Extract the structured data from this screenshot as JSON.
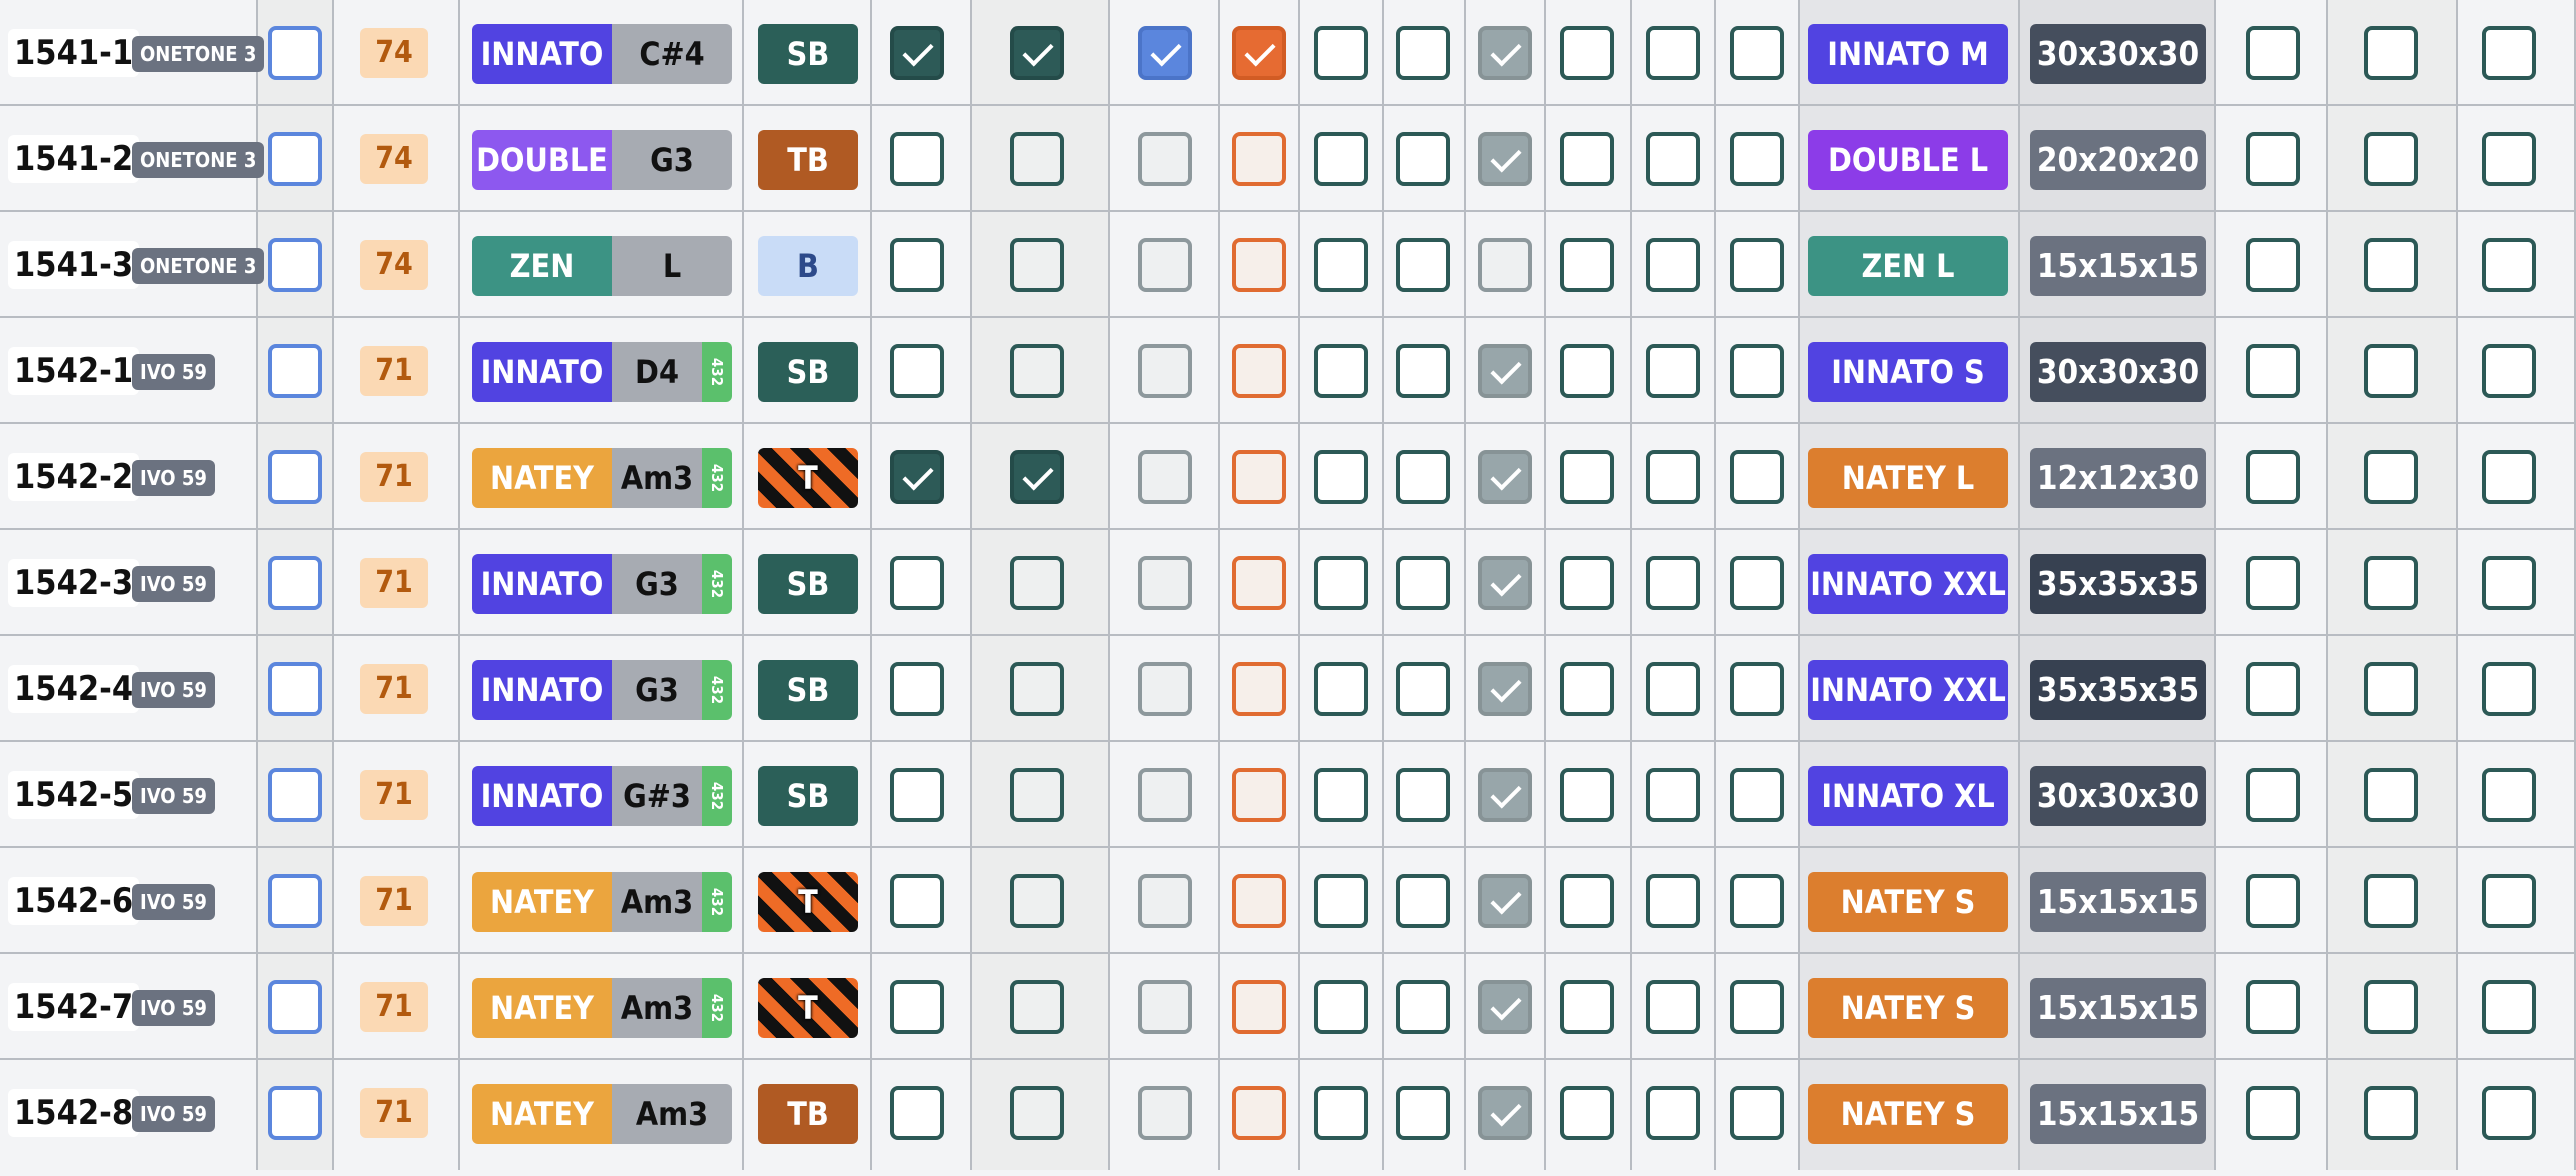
{
  "colors": {
    "INNATO": "#5143e1",
    "DOUBLE": "#8d58ef",
    "ZEN": "#3c9384",
    "NATEY": "#eba53e",
    "box_INNATO": "#5143e1",
    "box_DOUBLE": "#8c3ce8",
    "box_ZEN": "#3c9384",
    "box_NATEY": "#dc7e2e",
    "bag_SB": "#2b5f58",
    "bag_TB": "#b05a23",
    "bag_B": "#c9dcf7",
    "size_30x30x30": "#454e5d",
    "size_20x20x20": "#6b7280",
    "size_15x15x15": "#6b7280",
    "size_12x12x30": "#6b7280",
    "size_35x35x35": "#374151"
  },
  "rows": [
    {
      "order": "1541-1",
      "model": "ONETONE 3",
      "tuning": "74",
      "instrument": "INNATO",
      "note": "C#4",
      "hz": "",
      "bag": "SB",
      "bag_style": "solid",
      "box": "INNATO M",
      "size": "30x30x30",
      "checks": {
        "c1": false,
        "c2": true,
        "c3": true,
        "c4": true,
        "c5": true,
        "c6": false,
        "c7": false,
        "c8": true,
        "c9": false,
        "c10": false,
        "c11": false,
        "c12": false,
        "c13": false,
        "c14": false
      }
    },
    {
      "order": "1541-2",
      "model": "ONETONE 3",
      "tuning": "74",
      "instrument": "DOUBLE",
      "note": "G3",
      "hz": "",
      "bag": "TB",
      "bag_style": "solid",
      "box": "DOUBLE L",
      "size": "20x20x20",
      "checks": {
        "c1": false,
        "c2": false,
        "c3": false,
        "c4": false,
        "c5": false,
        "c6": false,
        "c7": false,
        "c8": true,
        "c9": false,
        "c10": false,
        "c11": false,
        "c12": false,
        "c13": false,
        "c14": false
      }
    },
    {
      "order": "1541-3",
      "model": "ONETONE 3",
      "tuning": "74",
      "instrument": "ZEN",
      "note": "L",
      "hz": "",
      "bag": "B",
      "bag_style": "solid",
      "box": "ZEN L",
      "size": "15x15x15",
      "checks": {
        "c1": false,
        "c2": false,
        "c3": false,
        "c4": false,
        "c5": false,
        "c6": false,
        "c7": false,
        "c8": false,
        "c9": false,
        "c10": false,
        "c11": false,
        "c12": false,
        "c13": false,
        "c14": false
      }
    },
    {
      "order": "1542-1",
      "model": "IVO 59",
      "tuning": "71",
      "instrument": "INNATO",
      "note": "D4",
      "hz": "432",
      "bag": "SB",
      "bag_style": "solid",
      "box": "INNATO S",
      "size": "30x30x30",
      "checks": {
        "c1": false,
        "c2": false,
        "c3": false,
        "c4": false,
        "c5": false,
        "c6": false,
        "c7": false,
        "c8": true,
        "c9": false,
        "c10": false,
        "c11": false,
        "c12": false,
        "c13": false,
        "c14": false
      }
    },
    {
      "order": "1542-2",
      "model": "IVO 59",
      "tuning": "71",
      "instrument": "NATEY",
      "note": "Am3",
      "hz": "432",
      "bag": "T",
      "bag_style": "stripe",
      "box": "NATEY L",
      "size": "12x12x30",
      "checks": {
        "c1": false,
        "c2": true,
        "c3": true,
        "c4": false,
        "c5": false,
        "c6": false,
        "c7": false,
        "c8": true,
        "c9": false,
        "c10": false,
        "c11": false,
        "c12": false,
        "c13": false,
        "c14": false
      }
    },
    {
      "order": "1542-3",
      "model": "IVO 59",
      "tuning": "71",
      "instrument": "INNATO",
      "note": "G3",
      "hz": "432",
      "bag": "SB",
      "bag_style": "solid",
      "box": "INNATO XXL",
      "size": "35x35x35",
      "checks": {
        "c1": false,
        "c2": false,
        "c3": false,
        "c4": false,
        "c5": false,
        "c6": false,
        "c7": false,
        "c8": true,
        "c9": false,
        "c10": false,
        "c11": false,
        "c12": false,
        "c13": false,
        "c14": false
      }
    },
    {
      "order": "1542-4",
      "model": "IVO 59",
      "tuning": "71",
      "instrument": "INNATO",
      "note": "G3",
      "hz": "432",
      "bag": "SB",
      "bag_style": "solid",
      "box": "INNATO XXL",
      "size": "35x35x35",
      "checks": {
        "c1": false,
        "c2": false,
        "c3": false,
        "c4": false,
        "c5": false,
        "c6": false,
        "c7": false,
        "c8": true,
        "c9": false,
        "c10": false,
        "c11": false,
        "c12": false,
        "c13": false,
        "c14": false
      }
    },
    {
      "order": "1542-5",
      "model": "IVO 59",
      "tuning": "71",
      "instrument": "INNATO",
      "note": "G#3",
      "hz": "432",
      "bag": "SB",
      "bag_style": "solid",
      "box": "INNATO XL",
      "size": "30x30x30",
      "checks": {
        "c1": false,
        "c2": false,
        "c3": false,
        "c4": false,
        "c5": false,
        "c6": false,
        "c7": false,
        "c8": true,
        "c9": false,
        "c10": false,
        "c11": false,
        "c12": false,
        "c13": false,
        "c14": false
      }
    },
    {
      "order": "1542-6",
      "model": "IVO 59",
      "tuning": "71",
      "instrument": "NATEY",
      "note": "Am3",
      "hz": "432",
      "bag": "T",
      "bag_style": "stripe",
      "box": "NATEY S",
      "size": "15x15x15",
      "checks": {
        "c1": false,
        "c2": false,
        "c3": false,
        "c4": false,
        "c5": false,
        "c6": false,
        "c7": false,
        "c8": true,
        "c9": false,
        "c10": false,
        "c11": false,
        "c12": false,
        "c13": false,
        "c14": false
      }
    },
    {
      "order": "1542-7",
      "model": "IVO 59",
      "tuning": "71",
      "instrument": "NATEY",
      "note": "Am3",
      "hz": "432",
      "bag": "T",
      "bag_style": "stripe",
      "box": "NATEY S",
      "size": "15x15x15",
      "checks": {
        "c1": false,
        "c2": false,
        "c3": false,
        "c4": false,
        "c5": false,
        "c6": false,
        "c7": false,
        "c8": true,
        "c9": false,
        "c10": false,
        "c11": false,
        "c12": false,
        "c13": false,
        "c14": false
      }
    },
    {
      "order": "1542-8",
      "model": "IVO 59",
      "tuning": "71",
      "instrument": "NATEY",
      "note": "Am3",
      "hz": "",
      "bag": "TB",
      "bag_style": "solid",
      "box": "NATEY S",
      "size": "15x15x15",
      "checks": {
        "c1": false,
        "c2": false,
        "c3": false,
        "c4": false,
        "c5": false,
        "c6": false,
        "c7": false,
        "c8": true,
        "c9": false,
        "c10": false,
        "c11": false,
        "c12": false,
        "c13": false,
        "c14": false
      }
    }
  ]
}
